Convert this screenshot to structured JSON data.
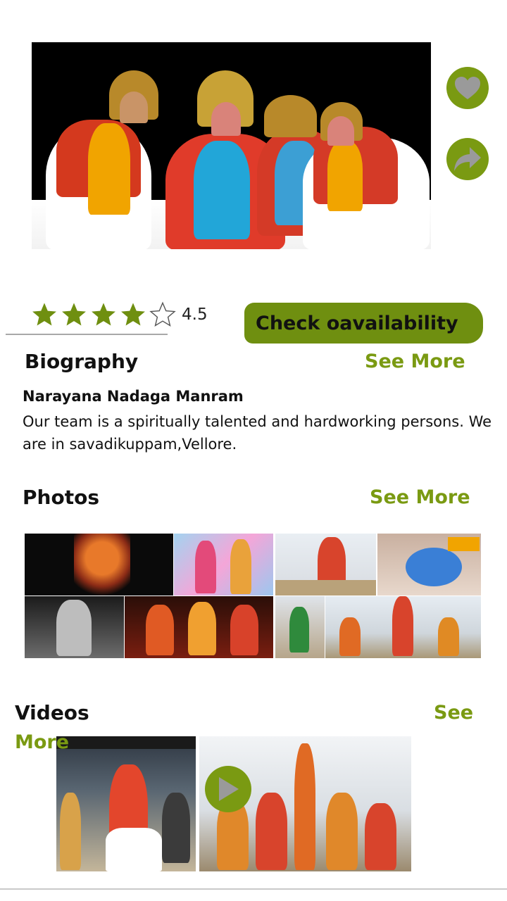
{
  "hero": {
    "alt": "Kattaikkuttu performers in costume"
  },
  "actions": {
    "favorite_icon": "heart-icon",
    "share_icon": "share-arrow-icon"
  },
  "rating": {
    "value": "4.5",
    "stars_filled": 4,
    "stars_total": 5
  },
  "check_button": {
    "label": "Check oavailability"
  },
  "biography": {
    "title": "Biography",
    "see_more": "See More",
    "name": "Narayana Nadaga Manram",
    "text_line1": "Our team is a spiritually talented and hardworking persons. We",
    "text_line2": "are in savadikuppam,Vellore."
  },
  "photos": {
    "title": "Photos",
    "see_more": "See More"
  },
  "videos": {
    "title": "Videos",
    "see_more_line1": "See",
    "see_more_line2": "More"
  },
  "colors": {
    "accent": "#7a9a12",
    "accent_dark": "#6f8f10",
    "divider": "#a8a8a8"
  }
}
